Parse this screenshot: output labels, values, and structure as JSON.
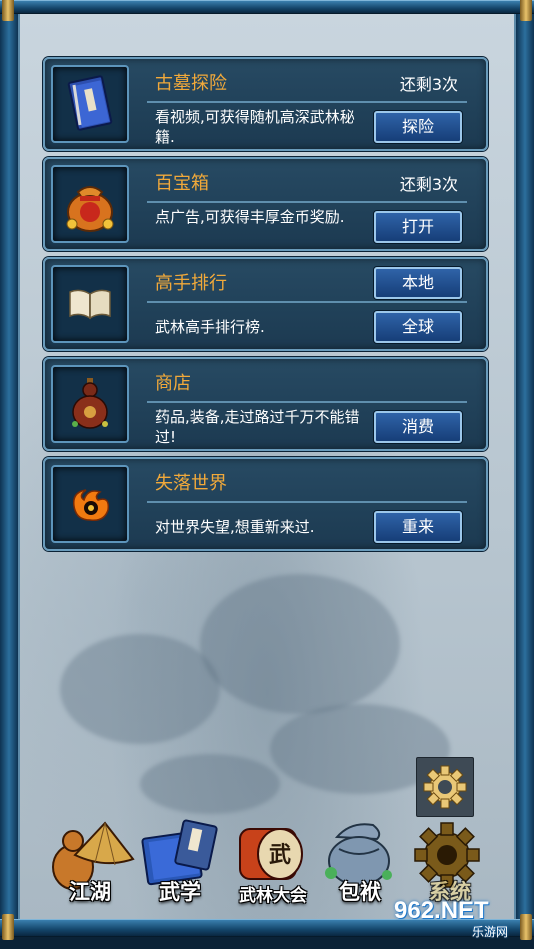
{
  "cards": [
    {
      "title": "古墓探险",
      "remaining": "还剩3次",
      "desc": "看视频,可获得随机高深武林秘籍.",
      "button": "探险",
      "icon": "book-icon"
    },
    {
      "title": "百宝箱",
      "remaining": "还剩3次",
      "desc": "点广告,可获得丰厚金币奖励.",
      "button": "打开",
      "icon": "treasure-bag-icon"
    },
    {
      "title": "高手排行",
      "desc": "武林高手排行榜.",
      "button_top": "本地",
      "button": "全球",
      "icon": "open-book-icon"
    },
    {
      "title": "商店",
      "desc": "药品,装备,走过路过千万不能错过!",
      "button": "消费",
      "icon": "gourd-icon"
    },
    {
      "title": "失落世界",
      "desc": "对世界失望,想重新来过.",
      "button": "重来",
      "icon": "flame-icon"
    }
  ],
  "nav": [
    {
      "label": "江湖",
      "icon": "hat-gourd-icon"
    },
    {
      "label": "武学",
      "icon": "scroll-book-icon"
    },
    {
      "label": "武林大会",
      "icon": "drum-icon"
    },
    {
      "label": "包袱",
      "icon": "bag-icon"
    },
    {
      "label": "系统",
      "icon": "gear-icon"
    }
  ],
  "drum_char": "武",
  "watermark": {
    "main": "962.NET",
    "sub": "乐游网"
  },
  "colors": {
    "title": "#f1a93a",
    "panel": "#1c3a51",
    "button": "#1f4f8f",
    "frame": "#2c6f9d"
  }
}
